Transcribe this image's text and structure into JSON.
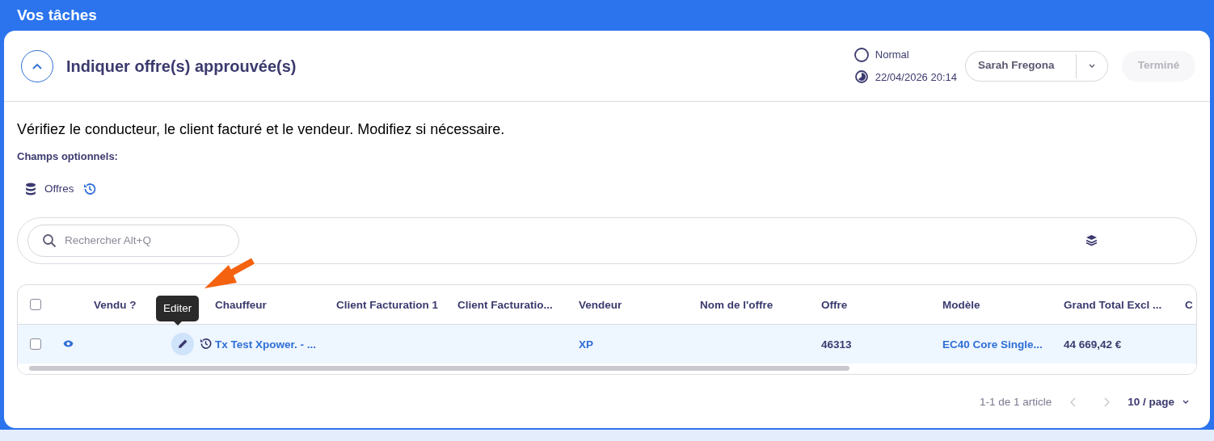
{
  "header": {
    "title": "Vos tâches"
  },
  "task": {
    "title": "Indiquer offre(s) approuvée(s)",
    "expanded": true,
    "priority": "Normal",
    "due": "22/04/2026 20:14",
    "assignee": "Sarah Fregona",
    "done_button": {
      "label": "Terminé",
      "disabled": true
    }
  },
  "instructions": "Vérifiez le conducteur, le client facturé et le vendeur. Modifiez si nécessaire.",
  "optional_label": "Champs optionnels:",
  "optional_fields": [
    {
      "label": "Offres"
    }
  ],
  "search": {
    "placeholder": "Rechercher Alt+Q"
  },
  "table": {
    "all_selected": false,
    "columns": [
      {
        "label": "Vendu ?",
        "kind": "actions"
      },
      {
        "label": "Chauffeur",
        "kind": "link"
      },
      {
        "label": "Client Facturation 1",
        "kind": "text"
      },
      {
        "label": "Client Facturatio...",
        "kind": "text"
      },
      {
        "label": "Vendeur",
        "kind": "link"
      },
      {
        "label": "Nom de l'offre",
        "kind": "text"
      },
      {
        "label": "Offre",
        "kind": "text"
      },
      {
        "label": "Modèle",
        "kind": "link"
      },
      {
        "label": "Grand Total Excl ...",
        "kind": "text"
      },
      {
        "label": "C",
        "kind": "text"
      }
    ],
    "rows": [
      {
        "selected": false,
        "cells": [
          null,
          "Tx Test Xpower. - ...",
          null,
          null,
          "XP",
          null,
          "46313",
          "EC40 Core Single...",
          "44 669,42 €",
          null
        ]
      }
    ]
  },
  "tooltip": "Editer",
  "pagination": {
    "summary": "1-1 de 1 article",
    "page_size": "10 / page"
  }
}
